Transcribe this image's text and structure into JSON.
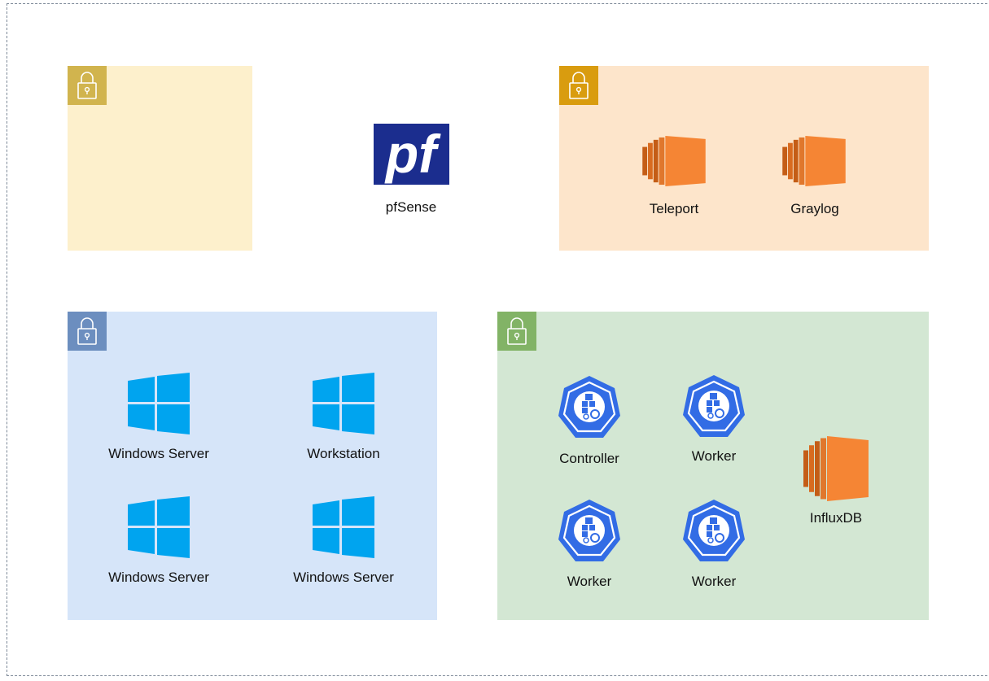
{
  "diagram": {
    "firewall": {
      "label": "pfSense",
      "icon": "pfsense-logo-icon",
      "logo_text": "pf"
    },
    "zones": {
      "yellow": {
        "icon": "lock-icon",
        "color": "#fdf0cc"
      },
      "orange": {
        "icon": "lock-icon",
        "color": "#fde5cb",
        "nodes": [
          {
            "label": "Teleport",
            "icon": "ec2-instance-icon"
          },
          {
            "label": "Graylog",
            "icon": "ec2-instance-icon"
          }
        ]
      },
      "blue": {
        "icon": "lock-icon",
        "color": "#d6e5f9",
        "nodes": [
          {
            "label": "Windows Server",
            "icon": "windows-icon"
          },
          {
            "label": "Workstation",
            "icon": "windows-icon"
          },
          {
            "label": "Windows Server",
            "icon": "windows-icon"
          },
          {
            "label": "Windows Server",
            "icon": "windows-icon"
          }
        ]
      },
      "green": {
        "icon": "lock-icon",
        "color": "#d3e7d3",
        "nodes": [
          {
            "label": "Controller",
            "icon": "kubernetes-node-icon"
          },
          {
            "label": "Worker",
            "icon": "kubernetes-node-icon"
          },
          {
            "label": "Worker",
            "icon": "kubernetes-node-icon"
          },
          {
            "label": "Worker",
            "icon": "kubernetes-node-icon"
          },
          {
            "label": "InfluxDB",
            "icon": "ec2-instance-icon"
          }
        ]
      }
    }
  }
}
